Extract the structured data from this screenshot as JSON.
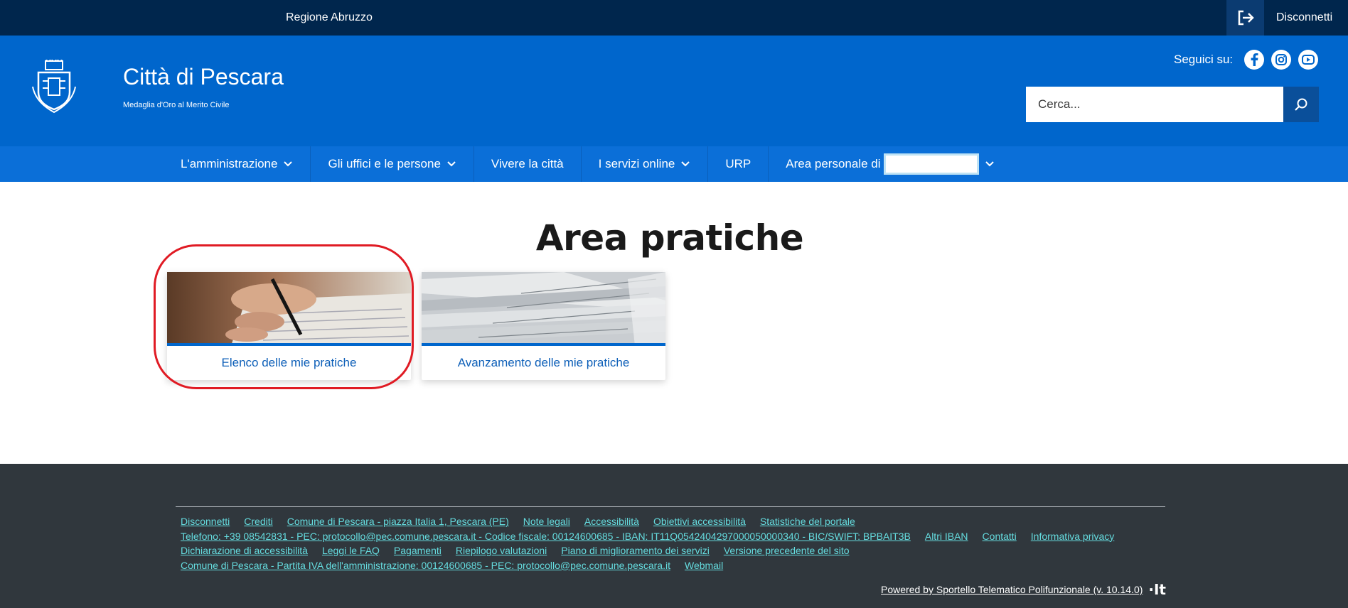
{
  "topbar": {
    "region": "Regione Abruzzo",
    "logout_label": "Disconnetti"
  },
  "header": {
    "title": "Città di Pescara",
    "subtitle": "Medaglia d'Oro al Merito Civile",
    "follow_label": "Seguici su:",
    "social": [
      "facebook-icon",
      "instagram-icon",
      "youtube-icon"
    ],
    "search_placeholder": "Cerca..."
  },
  "nav": {
    "items": [
      {
        "label": "L'amministrazione",
        "dropdown": true
      },
      {
        "label": "Gli uffici e le persone",
        "dropdown": true
      },
      {
        "label": "Vivere la città",
        "dropdown": false
      },
      {
        "label": "I servizi online",
        "dropdown": true
      },
      {
        "label": "URP",
        "dropdown": false
      },
      {
        "label": "Area personale di",
        "dropdown": true
      }
    ]
  },
  "main": {
    "title": "Area pratiche",
    "cards": [
      {
        "label": "Elenco delle mie pratiche"
      },
      {
        "label": "Avanzamento delle mie pratiche"
      }
    ]
  },
  "footer": {
    "rows": [
      [
        "Disconnetti",
        "Crediti",
        "Comune di Pescara - piazza Italia 1, Pescara (PE)",
        "Note legali",
        "Accessibilità",
        "Obiettivi accessibilità",
        "Statistiche del portale"
      ],
      [
        "Telefono: +39 08542831 - PEC: protocollo@pec.comune.pescara.it - Codice fiscale: 00124600685 - IBAN: IT11Q0542404297000050000340 - BIC/SWIFT: BPBAIT3B",
        "Altri IBAN",
        "Contatti",
        "Informativa privacy"
      ],
      [
        "Dichiarazione di accessibilità",
        "Leggi le FAQ",
        "Pagamenti",
        "Riepilogo valutazioni",
        "Piano di miglioramento dei servizi",
        "Versione precedente del sito"
      ],
      [
        "Comune di Pescara - Partita IVA dell'amministrazione: 00124600685 - PEC: protocollo@pec.comune.pescara.it",
        "Webmail"
      ]
    ],
    "powered": "Powered by Sportello Telematico Polifunzionale (v. 10.14.0)",
    "it_logo": "·It"
  },
  "colors": {
    "topbar": "#00264d",
    "header": "#0066cc",
    "navbar": "#0b6fd8",
    "footer": "#30373d",
    "footer_link": "#65dcdf",
    "highlight": "#e01b24"
  }
}
